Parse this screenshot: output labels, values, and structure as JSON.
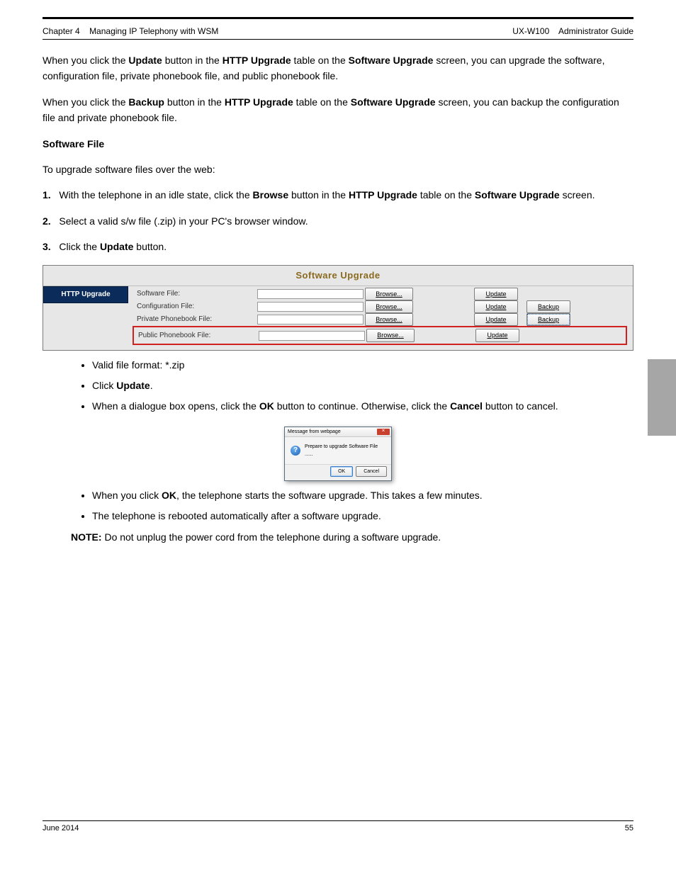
{
  "header": {
    "left_chapter": "Chapter 4",
    "left_title": "Managing IP Telephony with WSM",
    "right_product": "UX-W100",
    "right_manual": "Administrator Guide"
  },
  "text": {
    "line1_a": "When you click the ",
    "line1_b": "Update",
    "line1_c": " button in the ",
    "line1_d": "HTTP Upgrade",
    "line1_e": " table on the ",
    "line1_f": "Software Upgrade",
    "line2a": " screen, you can upgrade the software, configuration file, private phonebook file, and public",
    "line2b": "phonebook file.",
    "backup_a": "When you click the ",
    "backup_b": "Backup",
    "backup_c": " button in the ",
    "backup_d": "HTTP Upgrade",
    "backup_e": " table on the ",
    "backup_f": "Software Upgrade",
    "backup_g": " screen, you can backup the configuration file and private phonebook file.",
    "software_file_h": "Software File",
    "software_file_p": "To upgrade software files over the web:",
    "step1": "1.",
    "step1_a": "With the telephone in an idle state, click the ",
    "step1_b": "Browse",
    "step1_c": " button in the ",
    "step1_d": "HTTP Upgrade",
    "step1_e": " table on the",
    "step1_f": " Software Upgrade",
    "step1_g": " screen.",
    "step2": "2.",
    "step2_a": "Select a valid s/w file (.zip) in your PC's browser window.",
    "step3": "3.",
    "step3_a": "Click the ",
    "step3_b": "Update",
    "step3_c": " button.",
    "bul1": "Valid file format: *.zip",
    "bul2_a": "Click ",
    "bul2_b": "Update",
    "bul2_c": ".",
    "bul3_a": "When a dialogue box opens, click the ",
    "bul3_b": "OK",
    "bul3_c": " button to continue. Otherwise, click the ",
    "bul3_d": "Cancel",
    "bul3_e": " button to cancel.",
    "bul4_a": "When you click ",
    "bul4_b": "OK",
    "bul4_c": ", the telephone starts the software upgrade. This takes a few minutes.",
    "bul5": "The telephone is rebooted automatically after a software upgrade.",
    "note_label": "NOTE:",
    "note_body": " Do not unplug the power cord from the telephone during a software upgrade."
  },
  "panel": {
    "title": "Software Upgrade",
    "sidebar": "HTTP Upgrade",
    "rows": {
      "software": {
        "label": "Software File:",
        "browse": "Browse...",
        "update": "Update"
      },
      "config": {
        "label": "Configuration File:",
        "browse": "Browse...",
        "update": "Update",
        "backup": "Backup"
      },
      "private": {
        "label": "Private Phonebook File:",
        "browse": "Browse...",
        "update": "Update",
        "backup": "Backup"
      },
      "public": {
        "label": "Public Phonebook File:",
        "browse": "Browse...",
        "update": "Update"
      }
    }
  },
  "dialog": {
    "title": "Message from webpage",
    "message": "Prepare to upgrade Software File ......",
    "ok": "OK",
    "cancel": "Cancel"
  },
  "footer": {
    "date": "June  2014",
    "page": "55"
  }
}
